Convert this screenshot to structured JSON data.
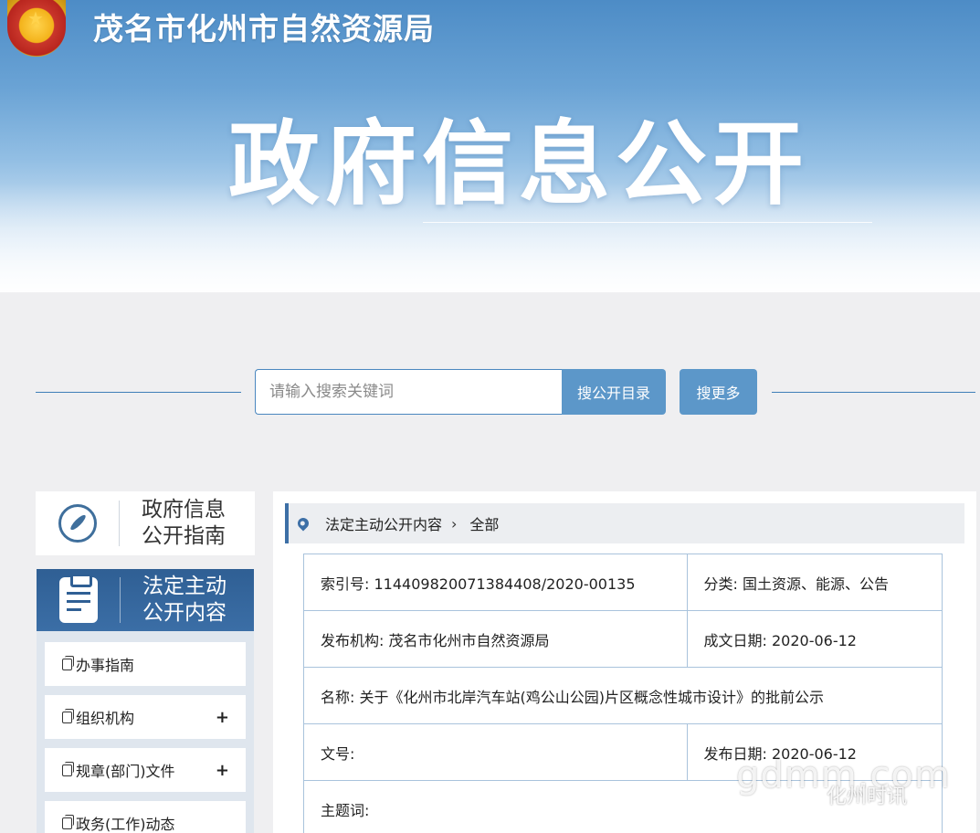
{
  "header": {
    "agency_name": "茂名市化州市自然资源局",
    "hero_title": "政府信息公开"
  },
  "search": {
    "placeholder": "请输入搜索关键词",
    "catalog_button": "搜公开目录",
    "more_button": "搜更多"
  },
  "sidebar": {
    "guide_label_1": "政府信息",
    "guide_label_2": "公开指南",
    "active_label_1": "法定主动",
    "active_label_2": "公开内容",
    "items": [
      {
        "label": "办事指南",
        "expand": ""
      },
      {
        "label": "组织机构",
        "expand": "+"
      },
      {
        "label": "规章(部门)文件",
        "expand": "+"
      },
      {
        "label": "政务(工作)动态",
        "expand": ""
      }
    ]
  },
  "breadcrumb": {
    "section": "法定主动公开内容",
    "current": "全部"
  },
  "info": {
    "index_label": "索引号:",
    "index_value": "114409820071384408/2020-00135",
    "category_label": "分类:",
    "category_value": "国土资源、能源、公告",
    "publisher_label": "发布机构:",
    "publisher_value": "茂名市化州市自然资源局",
    "written_date_label": "成文日期:",
    "written_date_value": "2020-06-12",
    "name_label": "名称:",
    "name_value": "关于《化州市北岸汽车站(鸡公山公园)片区概念性城市设计》的批前公示",
    "doc_no_label": "文号:",
    "doc_no_value": "",
    "publish_date_label": "发布日期:",
    "publish_date_value": "2020-06-12",
    "subject_label": "主题词:",
    "subject_value": ""
  },
  "watermark": {
    "site": "gdmm.com",
    "account": "化州时讯"
  }
}
